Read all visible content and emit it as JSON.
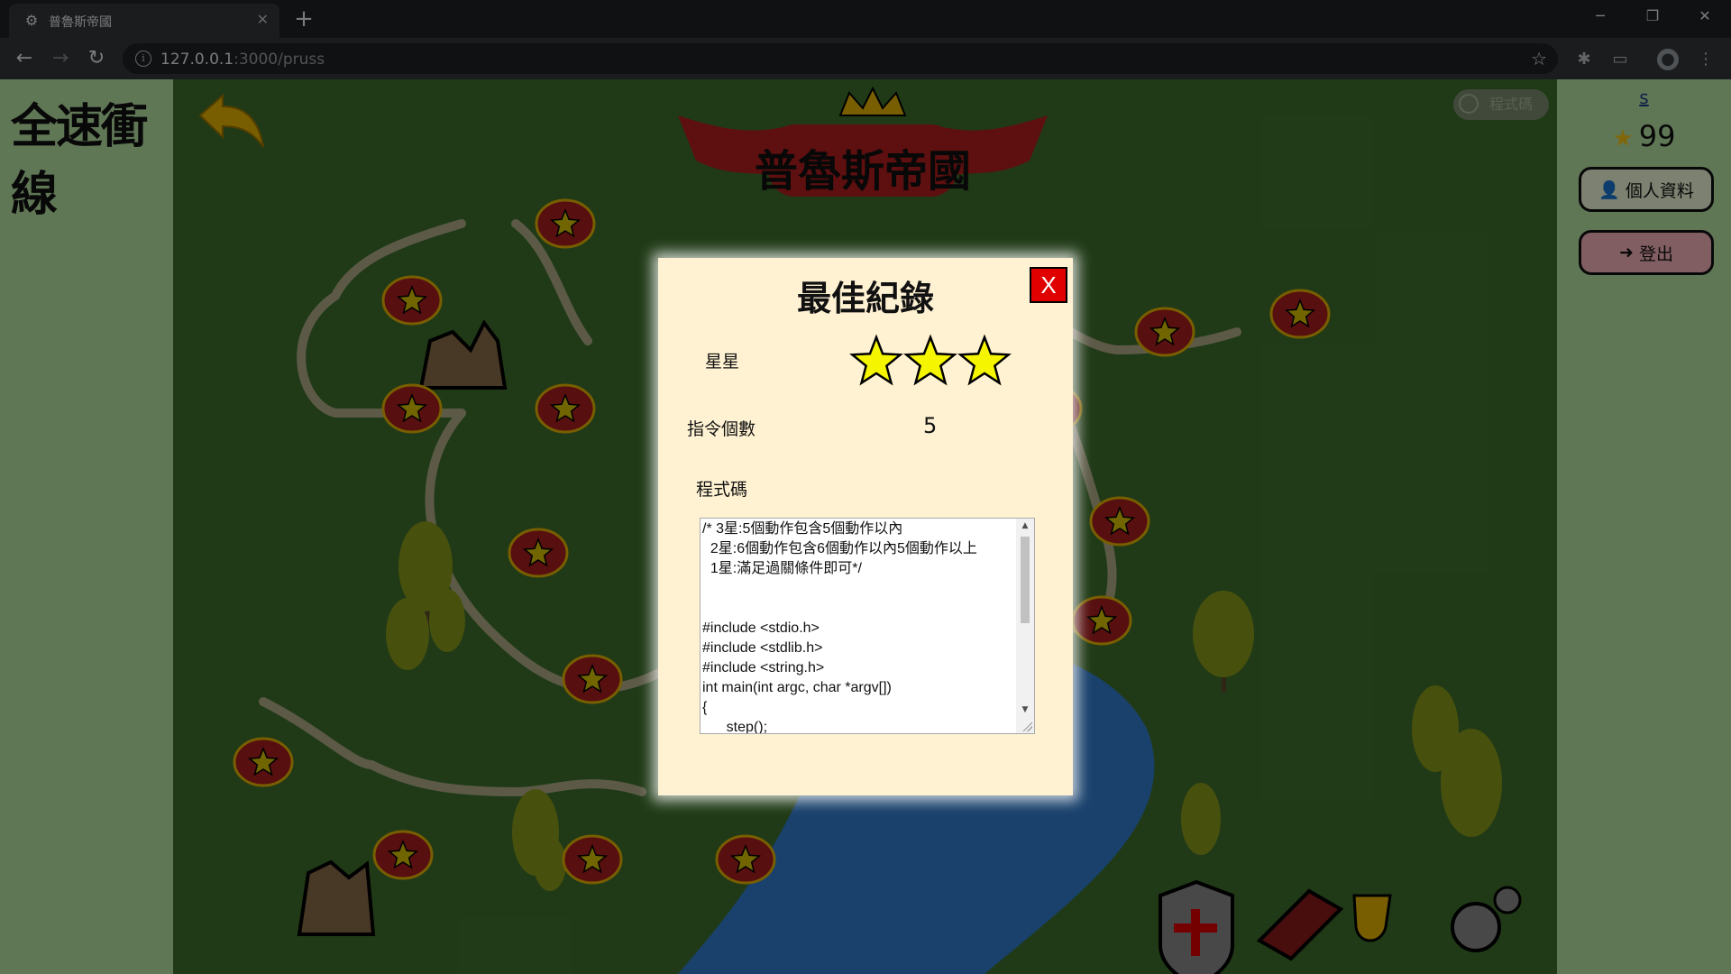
{
  "browser": {
    "tab_title": "普魯斯帝國",
    "url_host": "127.0.0.1",
    "url_path": ":3000/pruss"
  },
  "logo": {
    "text": "全速衝線"
  },
  "map": {
    "banner_title": "普魯斯帝國",
    "code_toggle_label": "程式碼"
  },
  "user": {
    "name": "s",
    "coins": "99",
    "profile_label": "個人資料",
    "logout_label": "登出"
  },
  "modal": {
    "title": "最佳紀錄",
    "close_label": "X",
    "stars_label": "星星",
    "stars_count": 3,
    "stars_max": 3,
    "commands_label": "指令個數",
    "commands_value": "5",
    "code_label": "程式碼",
    "code_text": "/* 3星:5個動作包含5個動作以內\n  2星:6個動作包含6個動作以內5個動作以上\n  1星:滿足過關條件即可*/\n\n\n#include <stdio.h>\n#include <stdlib.h>\n#include <string.h>\nint main(int argc, char *argv[])\n{\n      step();"
  },
  "colors": {
    "sidebar_bg": "#b9e5a5",
    "map_bg": "#3f6f2d",
    "modal_bg": "#fff2d2",
    "close_bg": "#e00000",
    "star_yellow": "#f5f500",
    "logout_bg": "#f7b5bd",
    "profile_bg": "#eef8d8"
  }
}
